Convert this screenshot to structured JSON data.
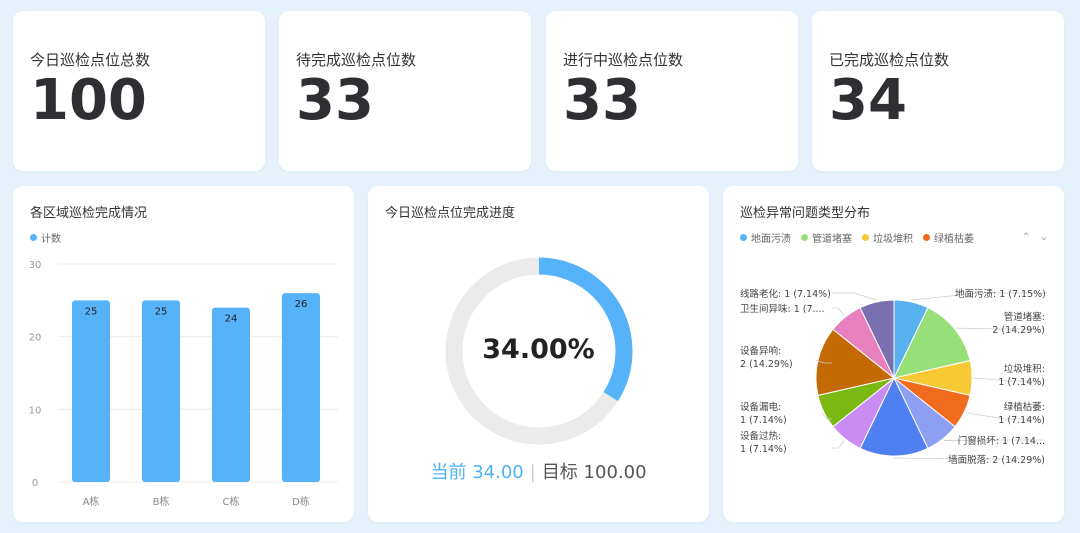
{
  "stats": [
    {
      "label": "今日巡检点位总数",
      "value": "100"
    },
    {
      "label": "待完成巡检点位数",
      "value": "33"
    },
    {
      "label": "进行中巡检点位数",
      "value": "33"
    },
    {
      "label": "已完成巡检点位数",
      "value": "34"
    }
  ],
  "bar_panel": {
    "title": "各区域巡检完成情况",
    "legend": "计数"
  },
  "progress_panel": {
    "title": "今日巡检点位完成进度",
    "percent_text": "34.00%",
    "current_text": "当前 34.00",
    "target_text": "目标 100.00",
    "progress": 0.34
  },
  "pie_panel": {
    "title": "巡检异常问题类型分布",
    "legend": [
      "地面污渍",
      "管道堵塞",
      "垃圾堆积",
      "绿植枯萎"
    ],
    "pager_up": "⌃",
    "pager_down": "⌄"
  },
  "colors": {
    "accent": "#56b2f9",
    "track": "#ebebeb",
    "legend": [
      "#5ab1ef",
      "#97e079",
      "#f7c934",
      "#f26b1d"
    ]
  },
  "chart_data": [
    {
      "type": "bar",
      "categories": [
        "A栋",
        "B栋",
        "C栋",
        "D栋"
      ],
      "series": [
        {
          "name": "计数",
          "values": [
            25,
            25,
            24,
            26
          ]
        }
      ],
      "ylim": [
        0,
        30
      ],
      "yticks": [
        0,
        10,
        20,
        30
      ],
      "grid": true,
      "legend": "top-left"
    },
    {
      "type": "pie",
      "slices": [
        {
          "name": "地面污渍",
          "value": 1,
          "label": "地面污渍: 1 (7.15%)",
          "color": "#5ab1ef"
        },
        {
          "name": "管道堵塞",
          "value": 2,
          "label": "管道堵塞:\n2 (14.29%)",
          "color": "#97e079"
        },
        {
          "name": "垃圾堆积",
          "value": 1,
          "label": "垃圾堆积:\n1 (7.14%)",
          "color": "#f7c934"
        },
        {
          "name": "绿植枯萎",
          "value": 1,
          "label": "绿植枯萎:\n1 (7.14%)",
          "color": "#f26b1d"
        },
        {
          "name": "门窗损坏",
          "value": 1,
          "label": "门窗损坏: 1 (7.14...",
          "color": "#8c9ff2"
        },
        {
          "name": "墙面脱落",
          "value": 2,
          "label": "墙面脱落: 2 (14.29%)",
          "color": "#4f7ff0"
        },
        {
          "name": "设备过热",
          "value": 1,
          "label": "设备过热:\n1 (7.14%)",
          "color": "#c88cf4"
        },
        {
          "name": "设备漏电",
          "value": 1,
          "label": "设备漏电:\n1 (7.14%)",
          "color": "#7cb812"
        },
        {
          "name": "设备异响",
          "value": 2,
          "label": "设备异响:\n2 (14.29%)",
          "color": "#c46a05"
        },
        {
          "name": "卫生间异味",
          "value": 1,
          "label": "卫生间异味: 1 (7....",
          "color": "#e87fbf"
        },
        {
          "name": "线路老化",
          "value": 1,
          "label": "线路老化: 1 (7.14%)",
          "color": "#7a6fb0"
        }
      ],
      "legend": "top-left"
    }
  ]
}
